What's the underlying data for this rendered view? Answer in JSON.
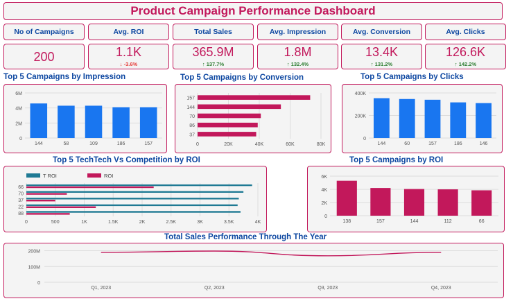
{
  "header": {
    "title": "Product Campaign Performance Dashboard"
  },
  "kpis": [
    {
      "label": "No of Campaigns",
      "value": "200",
      "delta": "",
      "direction": ""
    },
    {
      "label": "Avg. ROI",
      "value": "1.1K",
      "delta": "-3.6%",
      "direction": "down"
    },
    {
      "label": "Total Sales",
      "value": "365.9M",
      "delta": "137.7%",
      "direction": "up"
    },
    {
      "label": "Avg. Impression",
      "value": "1.8M",
      "delta": "132.4%",
      "direction": "up"
    },
    {
      "label": "Avg. Conversion",
      "value": "13.4K",
      "delta": "131.2%",
      "direction": "up"
    },
    {
      "label": "Avg. Clicks",
      "value": "126.6K",
      "delta": "142.2%",
      "direction": "up"
    }
  ],
  "colors": {
    "blue": "#1976f0",
    "crimson": "#c2185b",
    "teal": "#1f7a94",
    "title_blue": "#0d47a1"
  },
  "chart_data": [
    {
      "id": "impression",
      "type": "bar",
      "title": "Top 5 Campaigns by Impression",
      "categories": [
        "144",
        "58",
        "109",
        "186",
        "157"
      ],
      "values": [
        4.6,
        4.3,
        4.3,
        4.1,
        4.1
      ],
      "yticks": [
        "0",
        "2M",
        "4M",
        "6M"
      ],
      "ylim": [
        0,
        6
      ],
      "color": "#1976f0"
    },
    {
      "id": "conversion",
      "type": "bar",
      "orientation": "horizontal",
      "title": "Top 5 Campaigns by Conversion",
      "categories": [
        "157",
        "144",
        "70",
        "86",
        "37"
      ],
      "values": [
        73000,
        54000,
        41000,
        39000,
        38000
      ],
      "xticks": [
        "0",
        "20K",
        "40K",
        "60K",
        "80K"
      ],
      "xlim": [
        0,
        80000
      ],
      "color": "#c2185b"
    },
    {
      "id": "clicks",
      "type": "bar",
      "title": "Top 5 Campaigns by Clicks",
      "categories": [
        "144",
        "60",
        "157",
        "186",
        "146"
      ],
      "values": [
        380000,
        372000,
        365000,
        340000,
        333000
      ],
      "yticks": [
        "0",
        "200K",
        "400K"
      ],
      "ylim": [
        0,
        430000
      ],
      "color": "#1976f0"
    },
    {
      "id": "techtech",
      "type": "bar",
      "orientation": "horizontal",
      "title": "Top 5 TechTech Vs Competition by ROI",
      "categories": [
        "66",
        "70",
        "37",
        "22",
        "88"
      ],
      "series": [
        {
          "name": "T ROI",
          "values": [
            3900,
            3750,
            3670,
            3650,
            3700
          ],
          "color": "#1f7a94"
        },
        {
          "name": "ROI",
          "values": [
            2200,
            700,
            500,
            1200,
            750
          ],
          "color": "#c2185b"
        }
      ],
      "xticks": [
        "0",
        "500",
        "1K",
        "1.5K",
        "2K",
        "2.5K",
        "3K",
        "3.5K",
        "4K"
      ],
      "xlim": [
        0,
        4000
      ],
      "legend": "top-left"
    },
    {
      "id": "roi",
      "type": "bar",
      "title": "Top 5 Campaigns by ROI",
      "categories": [
        "138",
        "157",
        "144",
        "112",
        "66"
      ],
      "values": [
        5300,
        4200,
        4050,
        4000,
        3850
      ],
      "yticks": [
        "0",
        "2K",
        "4K",
        "6K"
      ],
      "ylim": [
        0,
        6000
      ],
      "color": "#c2185b"
    },
    {
      "id": "sales",
      "type": "line",
      "title": "Total Sales Performance Through The Year",
      "categories": [
        "Q1, 2023",
        "Q2, 2023",
        "Q3, 2023",
        "Q4, 2023"
      ],
      "values": [
        190,
        198,
        168,
        190
      ],
      "yticks": [
        "0",
        "100M",
        "200M"
      ],
      "ylim": [
        0,
        220
      ],
      "color": "#c2185b"
    }
  ]
}
